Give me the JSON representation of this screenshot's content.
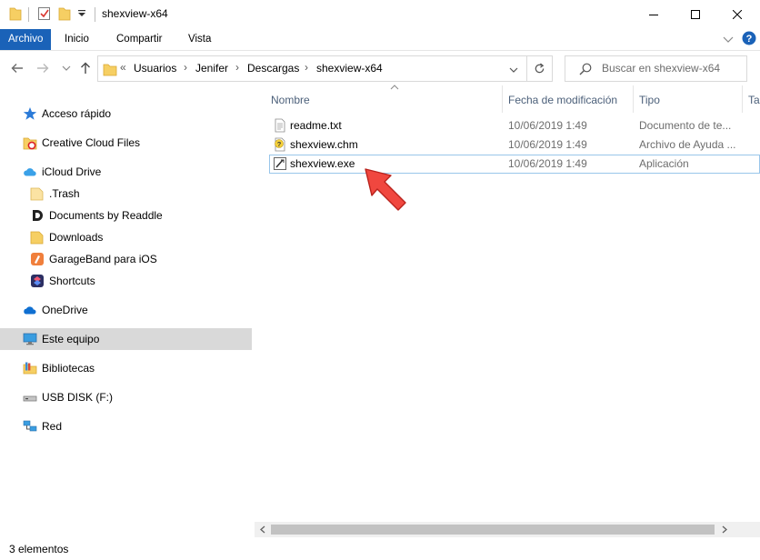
{
  "window": {
    "title": "shexview-x64"
  },
  "ribbon": {
    "tabs": [
      "Archivo",
      "Inicio",
      "Compartir",
      "Vista"
    ]
  },
  "address": {
    "overflow": "«",
    "crumbs": [
      "Usuarios",
      "Jenifer",
      "Descargas",
      "shexview-x64"
    ],
    "separator": "›"
  },
  "search": {
    "placeholder": "Buscar en shexview-x64"
  },
  "navigation": {
    "items": [
      {
        "label": "Acceso rápido",
        "icon": "star-icon"
      },
      {
        "label": "Creative Cloud Files",
        "icon": "creative-cloud-icon"
      },
      {
        "label": "iCloud Drive",
        "icon": "icloud-icon"
      },
      {
        "label": ".Trash",
        "icon": "folder-icon"
      },
      {
        "label": "Documents by Readdle",
        "icon": "readdle-icon"
      },
      {
        "label": "Downloads",
        "icon": "folder-icon"
      },
      {
        "label": "GarageBand para iOS",
        "icon": "garageband-icon"
      },
      {
        "label": "Shortcuts",
        "icon": "shortcuts-icon"
      },
      {
        "label": "OneDrive",
        "icon": "onedrive-icon"
      },
      {
        "label": "Este equipo",
        "icon": "computer-icon"
      },
      {
        "label": "Bibliotecas",
        "icon": "libraries-icon"
      },
      {
        "label": "USB DISK (F:)",
        "icon": "usb-drive-icon"
      },
      {
        "label": "Red",
        "icon": "network-icon"
      }
    ]
  },
  "columns": {
    "name": "Nombre",
    "date": "Fecha de modificación",
    "type": "Tipo",
    "size": "Ta"
  },
  "files": [
    {
      "name": "readme.txt",
      "date": "10/06/2019 1:49",
      "type": "Documento de te...",
      "icon": "text-file-icon"
    },
    {
      "name": "shexview.chm",
      "date": "10/06/2019 1:49",
      "type": "Archivo de Ayuda ...",
      "icon": "help-file-icon"
    },
    {
      "name": "shexview.exe",
      "date": "10/06/2019 1:49",
      "type": "Aplicación",
      "icon": "exe-file-icon"
    }
  ],
  "status": {
    "count": "3 elementos"
  },
  "colors": {
    "accent": "#1a62b8",
    "selection": "#d9d9d9",
    "arrow": "#f0473f"
  }
}
